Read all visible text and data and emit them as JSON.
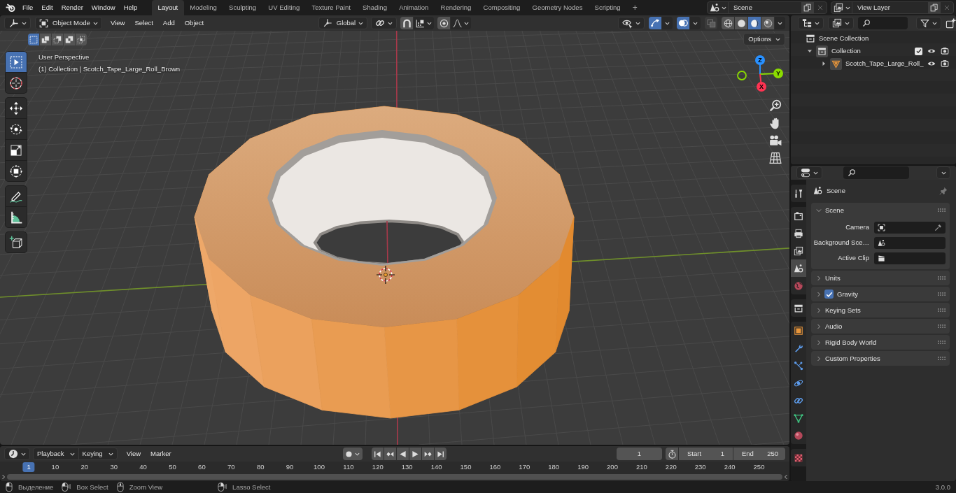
{
  "top_bar": {
    "menus": [
      "File",
      "Edit",
      "Render",
      "Window",
      "Help"
    ],
    "workspaces": [
      {
        "label": "Layout",
        "selected": true
      },
      {
        "label": "Modeling",
        "selected": false
      },
      {
        "label": "Sculpting",
        "selected": false
      },
      {
        "label": "UV Editing",
        "selected": false
      },
      {
        "label": "Texture Paint",
        "selected": false
      },
      {
        "label": "Shading",
        "selected": false
      },
      {
        "label": "Animation",
        "selected": false
      },
      {
        "label": "Rendering",
        "selected": false
      },
      {
        "label": "Compositing",
        "selected": false
      },
      {
        "label": "Geometry Nodes",
        "selected": false
      },
      {
        "label": "Scripting",
        "selected": false
      }
    ],
    "add_workspace": "+",
    "scene": "Scene",
    "view_layer": "View Layer"
  },
  "viewport": {
    "header": {
      "mode": "Object Mode",
      "menus": [
        "View",
        "Select",
        "Add",
        "Object"
      ],
      "orientation": "Global",
      "gizmos": true,
      "overlays": true,
      "shading": [
        {
          "kind": "wireframe",
          "selected": false
        },
        {
          "kind": "solid",
          "selected": false
        },
        {
          "kind": "material",
          "selected": true
        },
        {
          "kind": "rendered",
          "selected": false
        }
      ]
    },
    "select_modes": [
      {
        "kind": "new",
        "selected": true
      },
      {
        "kind": "extend",
        "selected": false
      },
      {
        "kind": "subtract",
        "selected": false
      },
      {
        "kind": "invert",
        "selected": false
      },
      {
        "kind": "intersect",
        "selected": false
      }
    ],
    "options": "Options",
    "tool_groups": [
      [
        {
          "kind": "select_box",
          "selected": true
        },
        {
          "kind": "cursor",
          "selected": false
        }
      ],
      [
        {
          "kind": "move",
          "selected": false
        },
        {
          "kind": "rotate",
          "selected": false
        },
        {
          "kind": "scale",
          "selected": false
        },
        {
          "kind": "transform",
          "selected": false
        }
      ],
      [
        {
          "kind": "annotate",
          "selected": false
        },
        {
          "kind": "measure",
          "selected": false
        }
      ],
      [
        {
          "kind": "add_cube",
          "selected": false
        }
      ]
    ],
    "view_name": "User Perspective",
    "object_info": "(1) Collection | Scotch_Tape_Large_Roll_Brown",
    "gizmo": {
      "axes": [
        {
          "label": "Z",
          "color": "#2890ff"
        },
        {
          "label": "Y",
          "color": "#8bdc00"
        },
        {
          "label": "X",
          "color": "#ff3352"
        }
      ]
    }
  },
  "outliner": {
    "tree": [
      {
        "label": "Scene Collection",
        "kind": "scene_collection",
        "children": [
          {
            "label": "Collection",
            "kind": "collection",
            "expanded": true,
            "checked": true,
            "children": [
              {
                "label": "Scotch_Tape_Large_Roll_",
                "kind": "mesh_object",
                "expanded": false
              }
            ]
          }
        ]
      }
    ]
  },
  "properties": {
    "tab_groups": [
      [
        {
          "kind": "tool",
          "selected": false
        }
      ],
      [
        {
          "kind": "render",
          "selected": false
        },
        {
          "kind": "output",
          "selected": false
        },
        {
          "kind": "view_layer",
          "selected": false
        },
        {
          "kind": "scene",
          "selected": true
        },
        {
          "kind": "world",
          "selected": false
        }
      ],
      [
        {
          "kind": "collection",
          "selected": false
        }
      ],
      [
        {
          "kind": "object",
          "selected": false
        },
        {
          "kind": "modifiers",
          "selected": false
        },
        {
          "kind": "particles",
          "selected": false
        },
        {
          "kind": "physics",
          "selected": false
        },
        {
          "kind": "constraints",
          "selected": false
        },
        {
          "kind": "data",
          "selected": false
        },
        {
          "kind": "material",
          "selected": false
        }
      ],
      [
        {
          "kind": "texture",
          "selected": false
        }
      ]
    ],
    "context": "Scene",
    "panels": [
      {
        "title": "Scene",
        "expanded": true,
        "fields": [
          {
            "label": "Camera",
            "kind": "camera"
          },
          {
            "label": "Background Sce…",
            "kind": "scene"
          },
          {
            "label": "Active Clip",
            "kind": "clip"
          }
        ]
      },
      {
        "title": "Units",
        "expanded": false
      },
      {
        "title": "Gravity",
        "expanded": false,
        "checkbox": {
          "checked": true
        }
      },
      {
        "title": "Keying Sets",
        "expanded": false
      },
      {
        "title": "Audio",
        "expanded": false
      },
      {
        "title": "Rigid Body World",
        "expanded": false
      },
      {
        "title": "Custom Properties",
        "expanded": false
      }
    ]
  },
  "timeline": {
    "menus": [
      {
        "label": "Playback",
        "kind": "dropdown"
      },
      {
        "label": "Keying",
        "kind": "dropdown"
      },
      {
        "label": "View",
        "kind": "menu"
      },
      {
        "label": "Marker",
        "kind": "menu"
      }
    ],
    "current_frame": "1",
    "start_label": "Start",
    "start": "1",
    "end_label": "End",
    "end": "250",
    "ruler": [
      {
        "label": "1",
        "selected": true
      },
      {
        "label": "10",
        "selected": false
      },
      {
        "label": "20",
        "selected": false
      },
      {
        "label": "30",
        "selected": false
      },
      {
        "label": "40",
        "selected": false
      },
      {
        "label": "50",
        "selected": false
      },
      {
        "label": "60",
        "selected": false
      },
      {
        "label": "70",
        "selected": false
      },
      {
        "label": "80",
        "selected": false
      },
      {
        "label": "90",
        "selected": false
      },
      {
        "label": "100",
        "selected": false
      },
      {
        "label": "110",
        "selected": false
      },
      {
        "label": "120",
        "selected": false
      },
      {
        "label": "130",
        "selected": false
      },
      {
        "label": "140",
        "selected": false
      },
      {
        "label": "150",
        "selected": false
      },
      {
        "label": "160",
        "selected": false
      },
      {
        "label": "170",
        "selected": false
      },
      {
        "label": "180",
        "selected": false
      },
      {
        "label": "190",
        "selected": false
      },
      {
        "label": "200",
        "selected": false
      },
      {
        "label": "210",
        "selected": false
      },
      {
        "label": "220",
        "selected": false
      },
      {
        "label": "230",
        "selected": false
      },
      {
        "label": "240",
        "selected": false
      },
      {
        "label": "250",
        "selected": false
      }
    ]
  },
  "status_bar": {
    "hints": [
      {
        "label": "Выделение",
        "kind": "left_click"
      },
      {
        "label": "Box Select",
        "kind": "left_drag"
      },
      {
        "label": "Zoom View",
        "kind": "middle_click"
      },
      {
        "label": "Lasso Select",
        "kind": "right_drag"
      }
    ],
    "version": "3.0.0"
  }
}
